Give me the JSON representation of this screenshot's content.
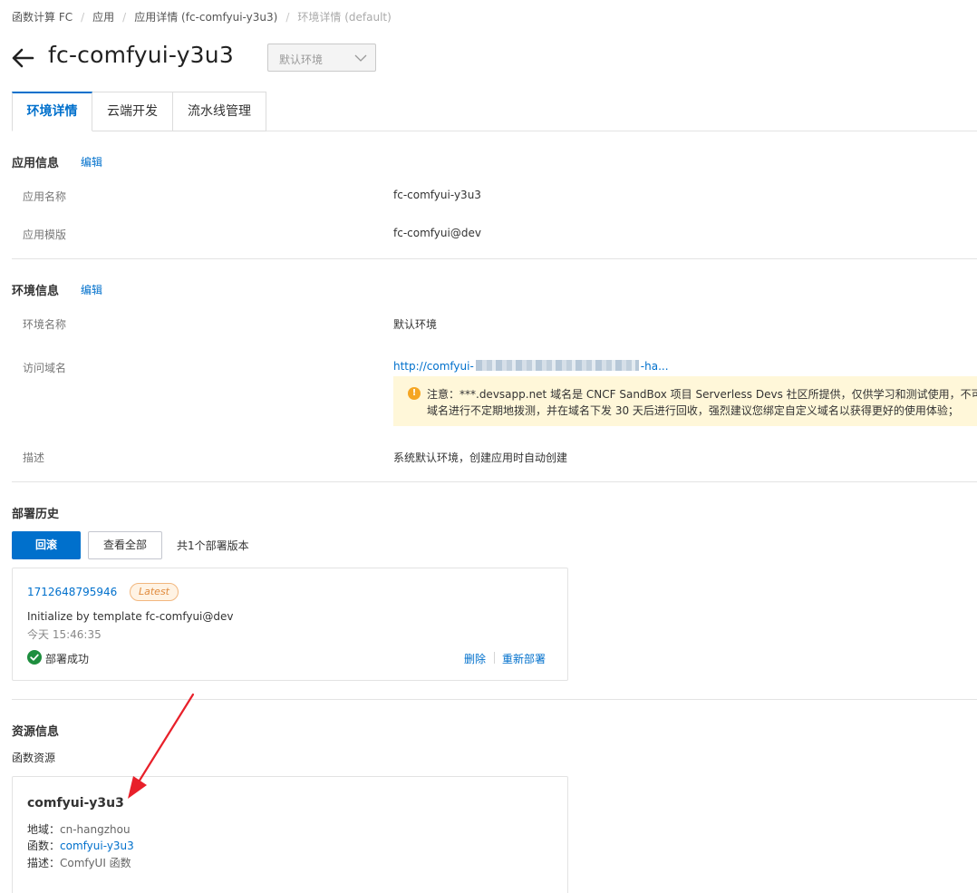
{
  "breadcrumb": {
    "items": [
      "函数计算 FC",
      "应用",
      "应用详情 (fc-comfyui-y3u3)"
    ],
    "current": "环境详情 (default)"
  },
  "header": {
    "title": "fc-comfyui-y3u3",
    "env_select": "默认环境"
  },
  "tabs": [
    "环境详情",
    "云端开发",
    "流水线管理"
  ],
  "app_info": {
    "title": "应用信息",
    "edit": "编辑",
    "name_label": "应用名称",
    "name_value": "fc-comfyui-y3u3",
    "template_label": "应用模版",
    "template_value": "fc-comfyui@dev"
  },
  "env_info": {
    "title": "环境信息",
    "edit": "编辑",
    "env_name_label": "环境名称",
    "env_name_value": "默认环境",
    "domain_label": "访问域名",
    "domain_prefix": "http://comfyui-",
    "domain_suffix": "-ha...",
    "notice_line1": "注意：***.devsapp.net 域名是 CNCF SandBox 项目 Serverless Devs 社区所提供，仅供学习和测试使用，不可用于",
    "notice_line2": "域名进行不定期地拨测，并在域名下发 30 天后进行回收，强烈建议您绑定自定义域名以获得更好的使用体验；",
    "desc_label": "描述",
    "desc_value": "系统默认环境，创建应用时自动创建"
  },
  "deploy": {
    "title": "部署历史",
    "rollback": "回滚",
    "view_all": "查看全部",
    "count_text": "共1个部署版本",
    "record": {
      "id": "1712648795946",
      "badge": "Latest",
      "message": "Initialize by template fc-comfyui@dev",
      "time": "今天 15:46:35",
      "status": "部署成功",
      "delete": "删除",
      "redeploy": "重新部署"
    }
  },
  "resource": {
    "title": "资源信息",
    "subtitle": "函数资源",
    "card": {
      "name": "comfyui-y3u3",
      "region_label": "地域：",
      "region_value": "cn-hangzhou",
      "function_label": "函数：",
      "function_value": "comfyui-y3u3",
      "desc_label": "描述：",
      "desc_value": "ComfyUI 函数"
    }
  },
  "colors": {
    "primary": "#0070cc",
    "warning_bg": "#fff7d9",
    "success": "#1e8e3e",
    "annotation_arrow": "#e8202a"
  }
}
